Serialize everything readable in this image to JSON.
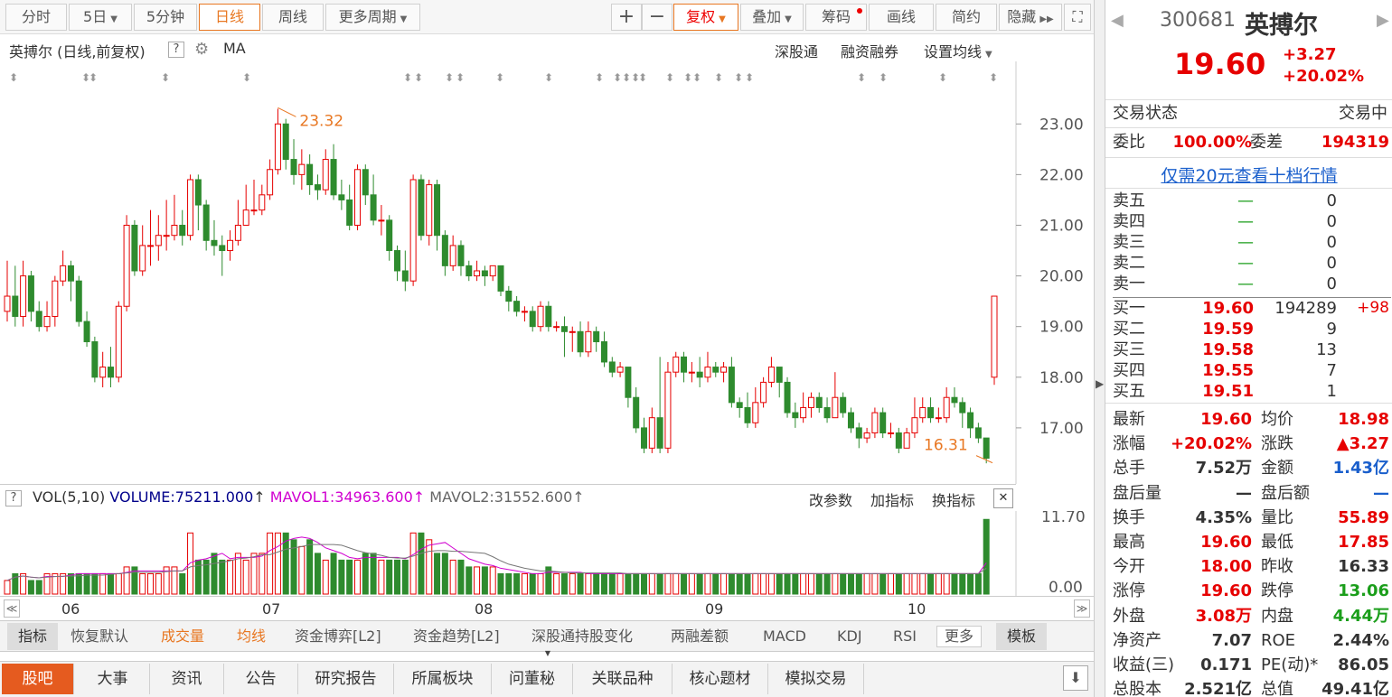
{
  "toolbar": {
    "fenshi": "分时",
    "five_day": "5日",
    "five_min": "5分钟",
    "daily": "日线",
    "weekly": "周线",
    "more_period": "更多周期",
    "plus": "+",
    "minus": "−",
    "fuquan": "复权",
    "diejia": "叠加",
    "chouma": "筹码",
    "huaxian": "画线",
    "jianyue": "简约",
    "yincang": "隐藏"
  },
  "chart_header": {
    "title": "英搏尔 (日线,前复权)",
    "help": "?",
    "ma": "MA",
    "sgt": "深股通",
    "rzrq": "融资融券",
    "set_ma": "设置均线"
  },
  "chart_data": {
    "type": "candlestick",
    "y_ticks": [
      "23.00",
      "22.00",
      "21.00",
      "20.00",
      "19.00",
      "18.00",
      "17.00"
    ],
    "ylim": [
      16.0,
      23.7
    ],
    "x_labels": [
      "06",
      "07",
      "08",
      "09",
      "10"
    ],
    "high_label": "23.32",
    "low_label": "16.31",
    "candles": [
      [
        19.3,
        19.6,
        20.3,
        19.1
      ],
      [
        19.6,
        19.2,
        20.2,
        19.0
      ],
      [
        19.2,
        20.0,
        20.3,
        19.0
      ],
      [
        20.0,
        19.3,
        20.1,
        19.1
      ],
      [
        19.3,
        19.0,
        19.5,
        18.9
      ],
      [
        19.0,
        19.2,
        19.5,
        18.9
      ],
      [
        19.2,
        19.9,
        20.0,
        19.0
      ],
      [
        19.9,
        20.2,
        20.5,
        19.8
      ],
      [
        20.2,
        19.9,
        20.3,
        19.5
      ],
      [
        19.9,
        19.1,
        20.0,
        19.0
      ],
      [
        19.1,
        18.7,
        19.3,
        18.6
      ],
      [
        18.7,
        18.0,
        18.8,
        17.9
      ],
      [
        18.0,
        18.2,
        18.5,
        17.8
      ],
      [
        18.2,
        18.0,
        18.6,
        17.8
      ],
      [
        18.0,
        19.4,
        19.5,
        17.9
      ],
      [
        19.4,
        21.0,
        21.2,
        19.3
      ],
      [
        21.0,
        20.1,
        21.1,
        20.0
      ],
      [
        20.1,
        20.6,
        21.0,
        20.0
      ],
      [
        20.6,
        20.6,
        21.3,
        20.2
      ],
      [
        20.6,
        20.8,
        21.2,
        20.3
      ],
      [
        20.8,
        20.8,
        21.5,
        20.5
      ],
      [
        20.8,
        21.0,
        21.6,
        20.7
      ],
      [
        21.0,
        20.8,
        21.3,
        20.6
      ],
      [
        20.8,
        21.9,
        22.0,
        20.7
      ],
      [
        21.9,
        21.4,
        22.0,
        20.9
      ],
      [
        21.4,
        20.7,
        21.5,
        20.5
      ],
      [
        20.7,
        20.6,
        21.1,
        20.4
      ],
      [
        20.6,
        20.5,
        20.8,
        20.0
      ],
      [
        20.5,
        20.7,
        20.9,
        20.3
      ],
      [
        20.7,
        21.0,
        21.5,
        20.6
      ],
      [
        21.0,
        21.3,
        21.8,
        21.0
      ],
      [
        21.3,
        21.3,
        21.9,
        21.2
      ],
      [
        21.3,
        21.6,
        21.8,
        21.2
      ],
      [
        21.6,
        22.1,
        22.3,
        21.5
      ],
      [
        22.1,
        23.0,
        23.3,
        22.0
      ],
      [
        23.0,
        22.3,
        23.1,
        22.1
      ],
      [
        22.3,
        22.0,
        22.7,
        21.8
      ],
      [
        22.0,
        22.2,
        22.5,
        21.7
      ],
      [
        22.2,
        21.8,
        22.4,
        21.6
      ],
      [
        21.8,
        21.7,
        22.0,
        21.5
      ],
      [
        21.7,
        22.3,
        22.5,
        21.6
      ],
      [
        22.3,
        21.6,
        22.6,
        21.5
      ],
      [
        21.6,
        21.5,
        21.9,
        21.3
      ],
      [
        21.5,
        21.0,
        21.8,
        20.9
      ],
      [
        21.0,
        22.1,
        22.2,
        20.9
      ],
      [
        22.1,
        21.6,
        22.2,
        21.4
      ],
      [
        21.6,
        21.1,
        22.0,
        21.0
      ],
      [
        21.1,
        21.1,
        21.4,
        20.8
      ],
      [
        21.1,
        20.5,
        21.2,
        20.3
      ],
      [
        20.5,
        20.1,
        20.6,
        19.9
      ],
      [
        20.1,
        19.9,
        20.5,
        19.7
      ],
      [
        19.9,
        21.9,
        22.0,
        19.8
      ],
      [
        21.9,
        20.8,
        22.0,
        20.7
      ],
      [
        20.8,
        21.8,
        21.9,
        20.6
      ],
      [
        21.8,
        20.8,
        21.9,
        20.5
      ],
      [
        20.8,
        20.2,
        20.9,
        20.0
      ],
      [
        20.2,
        20.6,
        20.8,
        20.1
      ],
      [
        20.6,
        20.2,
        20.7,
        20.0
      ],
      [
        20.2,
        20.0,
        20.3,
        19.9
      ],
      [
        20.0,
        20.1,
        20.3,
        19.9
      ],
      [
        20.1,
        20.0,
        20.2,
        19.8
      ],
      [
        20.0,
        20.2,
        20.2,
        19.9
      ],
      [
        20.2,
        19.7,
        20.2,
        19.6
      ],
      [
        19.7,
        19.5,
        19.8,
        19.3
      ],
      [
        19.5,
        19.3,
        19.6,
        19.2
      ],
      [
        19.3,
        19.3,
        19.4,
        19.1
      ],
      [
        19.3,
        19.0,
        19.4,
        18.9
      ],
      [
        19.0,
        19.4,
        19.5,
        18.9
      ],
      [
        19.4,
        19.0,
        19.5,
        18.9
      ],
      [
        19.0,
        19.0,
        19.1,
        18.9
      ],
      [
        19.0,
        18.9,
        19.2,
        18.4
      ],
      [
        18.9,
        18.9,
        19.0,
        18.5
      ],
      [
        18.9,
        18.5,
        19.1,
        18.4
      ],
      [
        18.5,
        18.9,
        19.1,
        18.4
      ],
      [
        18.9,
        18.7,
        19.0,
        18.5
      ],
      [
        18.7,
        18.3,
        18.9,
        18.2
      ],
      [
        18.3,
        18.1,
        18.4,
        18.0
      ],
      [
        18.1,
        18.2,
        18.3,
        18.0
      ],
      [
        18.2,
        17.6,
        18.2,
        17.4
      ],
      [
        17.6,
        17.0,
        17.8,
        16.9
      ],
      [
        17.0,
        16.6,
        17.2,
        16.5
      ],
      [
        16.6,
        17.2,
        17.4,
        16.5
      ],
      [
        17.2,
        16.6,
        18.4,
        16.5
      ],
      [
        16.6,
        18.1,
        18.3,
        16.5
      ],
      [
        18.1,
        18.4,
        18.5,
        18.0
      ],
      [
        18.4,
        18.1,
        18.5,
        17.9
      ],
      [
        18.1,
        18.1,
        18.3,
        17.9
      ],
      [
        18.1,
        18.0,
        18.4,
        17.8
      ],
      [
        18.0,
        18.2,
        18.5,
        17.9
      ],
      [
        18.2,
        18.1,
        18.3,
        18.0
      ],
      [
        18.1,
        18.2,
        18.3,
        17.9
      ],
      [
        18.2,
        17.5,
        18.4,
        17.4
      ],
      [
        17.5,
        17.4,
        17.6,
        17.2
      ],
      [
        17.4,
        17.1,
        17.7,
        17.0
      ],
      [
        17.1,
        17.5,
        17.8,
        17.0
      ],
      [
        17.5,
        17.9,
        18.0,
        17.4
      ],
      [
        17.9,
        18.2,
        18.4,
        17.8
      ],
      [
        18.2,
        17.9,
        18.2,
        17.6
      ],
      [
        17.9,
        17.3,
        18.0,
        17.2
      ],
      [
        17.3,
        17.2,
        17.5,
        17.0
      ],
      [
        17.2,
        17.4,
        17.7,
        17.1
      ],
      [
        17.4,
        17.6,
        17.7,
        17.2
      ],
      [
        17.6,
        17.4,
        17.7,
        17.3
      ],
      [
        17.4,
        17.2,
        17.6,
        17.1
      ],
      [
        17.2,
        17.6,
        18.1,
        17.2
      ],
      [
        17.6,
        17.3,
        17.7,
        17.2
      ],
      [
        17.3,
        17.0,
        17.4,
        16.9
      ],
      [
        17.0,
        16.8,
        17.1,
        16.6
      ],
      [
        16.8,
        16.9,
        17.0,
        16.7
      ],
      [
        16.9,
        17.3,
        17.4,
        16.8
      ],
      [
        17.3,
        16.9,
        17.4,
        16.8
      ],
      [
        16.9,
        16.9,
        17.1,
        16.8
      ],
      [
        16.9,
        16.6,
        17.0,
        16.5
      ],
      [
        16.6,
        16.9,
        17.0,
        16.6
      ],
      [
        16.9,
        17.2,
        17.6,
        16.8
      ],
      [
        17.2,
        17.4,
        17.6,
        17.1
      ],
      [
        17.4,
        17.2,
        17.6,
        17.1
      ],
      [
        17.2,
        17.2,
        17.4,
        17.1
      ],
      [
        17.2,
        17.6,
        17.8,
        17.1
      ],
      [
        17.6,
        17.5,
        17.8,
        17.4
      ],
      [
        17.5,
        17.3,
        17.6,
        17.0
      ],
      [
        17.3,
        17.0,
        17.4,
        16.8
      ],
      [
        17.0,
        16.8,
        17.1,
        16.7
      ],
      [
        16.8,
        16.4,
        16.8,
        16.3
      ],
      [
        18.0,
        19.6,
        19.6,
        17.85
      ]
    ],
    "vol_ticks": [
      "11.70",
      "0.00"
    ],
    "volumes": [
      2,
      3,
      3,
      2,
      2,
      3,
      3,
      3,
      3,
      3,
      3,
      3,
      3,
      3,
      3,
      4,
      4,
      3,
      3,
      3,
      4,
      4,
      3,
      9,
      5,
      5,
      6,
      5,
      5,
      6,
      5,
      6,
      6,
      9,
      9,
      9,
      8,
      7,
      8,
      6,
      5,
      6,
      5,
      5,
      5,
      6,
      6,
      5,
      5,
      5,
      5,
      9,
      9,
      8,
      6,
      6,
      5,
      5,
      4,
      4,
      4,
      4,
      3,
      3,
      3,
      3,
      3,
      3,
      4,
      3,
      3,
      3,
      3,
      3,
      3,
      3,
      3,
      3,
      3,
      3,
      3,
      3,
      3,
      3,
      3,
      3,
      3,
      3,
      3,
      3,
      3,
      3,
      3,
      3,
      3,
      3,
      3,
      3,
      3,
      3,
      3,
      3,
      3,
      3,
      3,
      3,
      3,
      3,
      3,
      3,
      3,
      3,
      3,
      3,
      3,
      3,
      3,
      3,
      3,
      3,
      3,
      3,
      3,
      11
    ]
  },
  "vol_header": {
    "q": "?",
    "vol": "VOL(5,10)",
    "volume": "VOLUME:75211.000",
    "mavol1": "MAVOL1:34963.600",
    "mavol2": "MAVOL2:31552.600",
    "arrow": "↑",
    "param": "改参数",
    "add": "加指标",
    "switch": "换指标",
    "close": "✕"
  },
  "indicator_tabs": [
    "指标",
    "恢复默认",
    "成交量",
    "均线",
    "资金博弈[L2]",
    "资金趋势[L2]",
    "深股通持股变化",
    "两融差额",
    "MACD",
    "KDJ",
    "RSI",
    "更多",
    "模板"
  ],
  "bottom_tabs": [
    "股吧",
    "大事",
    "资讯",
    "公告",
    "研究报告",
    "所属板块",
    "问董秘",
    "关联品种",
    "核心题材",
    "模拟交易"
  ],
  "quote": {
    "code": "300681",
    "name": "英搏尔",
    "price": "19.60",
    "change": "+3.27",
    "pct": "+20.02%"
  },
  "trade_state": {
    "label": "交易状态",
    "value": "交易中"
  },
  "weibi": {
    "label1": "委比",
    "val1": "100.00%",
    "label2": "委差",
    "val2": "194319"
  },
  "ten_level": "仅需20元查看十档行情",
  "sells": [
    {
      "l": "卖五",
      "p": "—",
      "v": "0"
    },
    {
      "l": "卖四",
      "p": "—",
      "v": "0"
    },
    {
      "l": "卖三",
      "p": "—",
      "v": "0"
    },
    {
      "l": "卖二",
      "p": "—",
      "v": "0"
    },
    {
      "l": "卖一",
      "p": "—",
      "v": "0"
    }
  ],
  "buys": [
    {
      "l": "买一",
      "p": "19.60",
      "v": "194289",
      "d": "+98"
    },
    {
      "l": "买二",
      "p": "19.59",
      "v": "9",
      "d": ""
    },
    {
      "l": "买三",
      "p": "19.58",
      "v": "13",
      "d": ""
    },
    {
      "l": "买四",
      "p": "19.55",
      "v": "7",
      "d": ""
    },
    {
      "l": "买五",
      "p": "19.51",
      "v": "1",
      "d": ""
    }
  ],
  "stats": [
    {
      "l1": "最新",
      "v1": "19.60",
      "c1": "red",
      "l2": "均价",
      "v2": "18.98",
      "c2": "red"
    },
    {
      "l1": "涨幅",
      "v1": "+20.02%",
      "c1": "red",
      "l2": "涨跌",
      "v2": "▲3.27",
      "c2": "red"
    },
    {
      "l1": "总手",
      "v1": "7.52万",
      "c1": "",
      "l2": "金额",
      "v2": "1.43亿",
      "c2": "blue"
    },
    {
      "l1": "盘后量",
      "v1": "—",
      "c1": "",
      "l2": "盘后额",
      "v2": "—",
      "c2": "blue"
    },
    {
      "l1": "换手",
      "v1": "4.35%",
      "c1": "",
      "l2": "量比",
      "v2": "55.89",
      "c2": "red"
    },
    {
      "l1": "最高",
      "v1": "19.60",
      "c1": "red",
      "l2": "最低",
      "v2": "17.85",
      "c2": "red"
    },
    {
      "l1": "今开",
      "v1": "18.00",
      "c1": "red",
      "l2": "昨收",
      "v2": "16.33",
      "c2": ""
    },
    {
      "l1": "涨停",
      "v1": "19.60",
      "c1": "red",
      "l2": "跌停",
      "v2": "13.06",
      "c2": "green"
    },
    {
      "l1": "外盘",
      "v1": "3.08万",
      "c1": "red",
      "l2": "内盘",
      "v2": "4.44万",
      "c2": "green"
    },
    {
      "l1": "净资产",
      "v1": "7.07",
      "c1": "",
      "l2": "ROE",
      "v2": "2.44%",
      "c2": ""
    },
    {
      "l1": "收益(三)",
      "v1": "0.171",
      "c1": "",
      "l2": "PE(动)*",
      "v2": "86.05",
      "c2": ""
    },
    {
      "l1": "总股本",
      "v1": "2.521亿",
      "c1": "",
      "l2": "总值",
      "v2": "49.41亿",
      "c2": ""
    }
  ],
  "colors": {
    "up": "#e60000",
    "down": "#2e8b2e",
    "accent": "#e87722",
    "active_tab": "#e55b1f"
  }
}
